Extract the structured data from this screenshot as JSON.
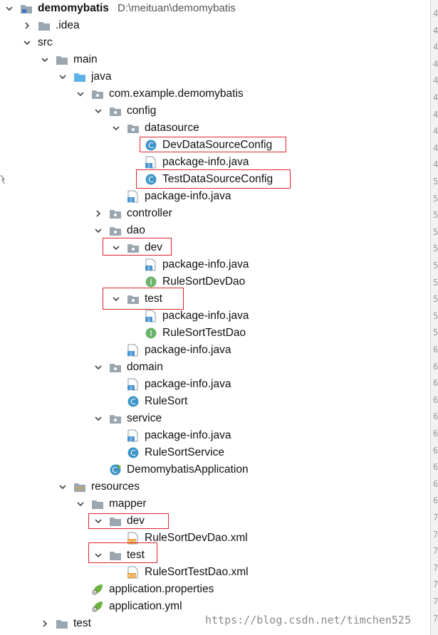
{
  "project": {
    "name": "demomybatis",
    "path": "D:\\meituan\\demomybatis"
  },
  "tree": [
    {
      "label": "demomybatis",
      "icon": "project-folder-icon",
      "arrow": "down",
      "level": 0,
      "bold": true
    },
    {
      "label": ".idea",
      "icon": "folder-icon",
      "arrow": "right",
      "level": 1
    },
    {
      "label": "src",
      "icon": "none",
      "arrow": "down",
      "level": 1
    },
    {
      "label": "main",
      "icon": "folder-icon",
      "arrow": "down",
      "level": 2
    },
    {
      "label": "java",
      "icon": "source-folder-icon",
      "arrow": "down",
      "level": 3
    },
    {
      "label": "com.example.demomybatis",
      "icon": "package-icon",
      "arrow": "down",
      "level": 4
    },
    {
      "label": "config",
      "icon": "package-icon",
      "arrow": "down",
      "level": 5
    },
    {
      "label": "datasource",
      "icon": "package-icon",
      "arrow": "down",
      "level": 6
    },
    {
      "label": "DevDataSourceConfig",
      "icon": "class-icon",
      "arrow": "none",
      "level": 7
    },
    {
      "label": "package-info.java",
      "icon": "java-file-icon",
      "arrow": "none",
      "level": 7
    },
    {
      "label": "TestDataSourceConfig",
      "icon": "class-icon",
      "arrow": "none",
      "level": 7
    },
    {
      "label": "package-info.java",
      "icon": "java-file-icon",
      "arrow": "none",
      "level": 6
    },
    {
      "label": "controller",
      "icon": "package-icon",
      "arrow": "right",
      "level": 5
    },
    {
      "label": "dao",
      "icon": "package-icon",
      "arrow": "down",
      "level": 5
    },
    {
      "label": "dev",
      "icon": "package-icon",
      "arrow": "down",
      "level": 6
    },
    {
      "label": "package-info.java",
      "icon": "java-file-icon",
      "arrow": "none",
      "level": 7
    },
    {
      "label": "RuleSortDevDao",
      "icon": "interface-icon",
      "arrow": "none",
      "level": 7
    },
    {
      "label": "test",
      "icon": "package-icon",
      "arrow": "down",
      "level": 6
    },
    {
      "label": "package-info.java",
      "icon": "java-file-icon",
      "arrow": "none",
      "level": 7
    },
    {
      "label": "RuleSortTestDao",
      "icon": "interface-icon",
      "arrow": "none",
      "level": 7
    },
    {
      "label": "package-info.java",
      "icon": "java-file-icon",
      "arrow": "none",
      "level": 6
    },
    {
      "label": "domain",
      "icon": "package-icon",
      "arrow": "down",
      "level": 5
    },
    {
      "label": "package-info.java",
      "icon": "java-file-icon",
      "arrow": "none",
      "level": 6
    },
    {
      "label": "RuleSort",
      "icon": "class-icon",
      "arrow": "none",
      "level": 6
    },
    {
      "label": "service",
      "icon": "package-icon",
      "arrow": "down",
      "level": 5
    },
    {
      "label": "package-info.java",
      "icon": "java-file-icon",
      "arrow": "none",
      "level": 6
    },
    {
      "label": "RuleSortService",
      "icon": "class-icon",
      "arrow": "none",
      "level": 6
    },
    {
      "label": "DemomybatisApplication",
      "icon": "spring-app-icon",
      "arrow": "none",
      "level": 5
    },
    {
      "label": "resources",
      "icon": "resources-folder-icon",
      "arrow": "down",
      "level": 3
    },
    {
      "label": "mapper",
      "icon": "folder-icon",
      "arrow": "down",
      "level": 4
    },
    {
      "label": "dev",
      "icon": "folder-icon",
      "arrow": "down",
      "level": 5
    },
    {
      "label": "RuleSortDevDao.xml",
      "icon": "xml-file-icon",
      "arrow": "none",
      "level": 6
    },
    {
      "label": "test",
      "icon": "folder-icon",
      "arrow": "down",
      "level": 5
    },
    {
      "label": "RuleSortTestDao.xml",
      "icon": "xml-file-icon",
      "arrow": "none",
      "level": 6
    },
    {
      "label": "application.properties",
      "icon": "spring-config-icon",
      "arrow": "none",
      "level": 4
    },
    {
      "label": "application.yml",
      "icon": "spring-config-icon",
      "arrow": "none",
      "level": 4
    },
    {
      "label": "test",
      "icon": "folder-icon",
      "arrow": "right",
      "level": 2
    }
  ],
  "gutter_digits": [
    "4",
    "4",
    "4",
    "4",
    "4",
    "4",
    "4",
    "4",
    "4",
    "4",
    "5",
    "5",
    "5",
    "5",
    "5",
    "5",
    "5",
    "5",
    "5",
    "5",
    "6",
    "6",
    "6",
    "6",
    "6",
    "6",
    "6",
    "6",
    "6",
    "6",
    "7",
    "7",
    "7",
    "7",
    "7",
    "7",
    "7"
  ],
  "watermark": "https://blog.csdn.net/timchen525",
  "colors": {
    "highlight": "#e0242c",
    "folder": "#9aa7b0",
    "source_folder": "#5fb2e6",
    "class": "#3e95c9",
    "interface": "#6cb46c",
    "spring": "#6db33f"
  }
}
